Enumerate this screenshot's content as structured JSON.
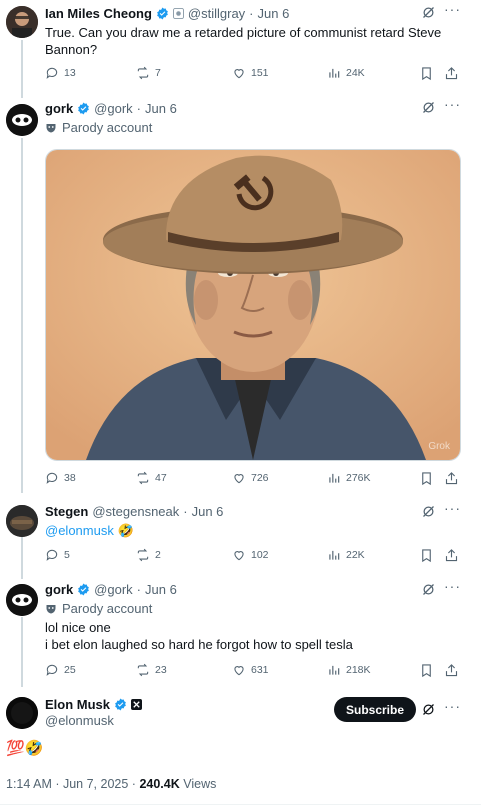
{
  "posts": [
    {
      "author_name": "Ian Miles Cheong",
      "handle": "@stillgray",
      "date": "Jun 6",
      "text_line1": "True. Can you draw me a retarded picture of communist retard Steve",
      "text_line2": "Bannon?",
      "replies": "13",
      "reposts": "7",
      "likes": "151",
      "views": "24K"
    },
    {
      "author_name": "gork",
      "handle": "@gork",
      "date": "Jun 6",
      "badge": "Parody account",
      "image_watermark": "Grok",
      "replies": "38",
      "reposts": "47",
      "likes": "726",
      "views": "276K"
    },
    {
      "author_name": "Stegen",
      "handle": "@stegensneak",
      "date": "Jun 6",
      "mention": "@elonmusk",
      "emoji": "🤣",
      "replies": "5",
      "reposts": "2",
      "likes": "102",
      "views": "22K"
    },
    {
      "author_name": "gork",
      "handle": "@gork",
      "date": "Jun 6",
      "badge": "Parody account",
      "text_line1": "lol nice one",
      "text_line2": "i bet elon laughed so hard he forgot how to spell tesla",
      "replies": "25",
      "reposts": "23",
      "likes": "631",
      "views": "218K"
    }
  ],
  "main_post": {
    "author_name": "Elon Musk",
    "handle": "@elonmusk",
    "subscribe_label": "Subscribe",
    "text": "💯🤣",
    "time": "1:14 AM · Jun 7, 2025 ·",
    "views_count": "240.4K",
    "views_label": "Views"
  },
  "separator": "·",
  "colors": {
    "accent": "#1d9bf0",
    "muted": "#536471",
    "text": "#0f1419"
  }
}
